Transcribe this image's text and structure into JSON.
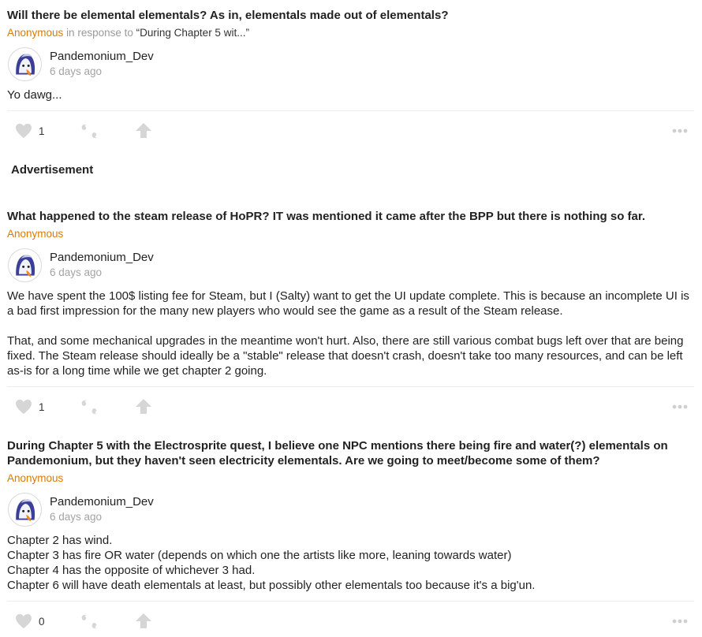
{
  "posts": [
    {
      "question": "Will there be elemental elementals? As in, elementals made out of elementals?",
      "asker": "Anonymous",
      "in_response_to": "in response to",
      "quoted": "“During Chapter 5 wit...”",
      "author": "Pandemonium_Dev",
      "time": "6 days ago",
      "answer": [
        "Yo dawg..."
      ],
      "likes": "1"
    },
    {
      "question": "What happened to the steam release of HoPR? IT was mentioned it came after the BPP but there is nothing so far.",
      "asker": "Anonymous",
      "author": "Pandemonium_Dev",
      "time": "6 days ago",
      "answer": [
        "We have spent the 100$ listing fee for Steam, but I (Salty) want to get the UI update complete. This is because an incomplete UI is a bad first impression for the many new players who would see the game as a result of the Steam release.",
        "That, and some mechanical upgrades in the meantime won't hurt. Also, there are still various combat bugs left over that are being fixed. The Steam release should ideally be a \"stable\" release that doesn't crash, doesn't take too many resources, and can be left as-is for a long time while we get chapter 2 going."
      ],
      "likes": "1"
    },
    {
      "question": "During Chapter 5 with the Electrosprite quest, I believe one NPC mentions there being fire and water(?) elementals on Pandemonium, but they haven't seen electricity elementals. Are we going to meet/become some of them?",
      "asker": "Anonymous",
      "author": "Pandemonium_Dev",
      "time": "6 days ago",
      "answer": [
        "Chapter 2 has wind.",
        "Chapter 3 has fire OR water (depends on which one the artists like more, leaning towards water)",
        "Chapter 4 has the opposite of whichever 3 had.",
        "Chapter 6 will have death elementals at least, but possibly other elementals too because it's a big'un."
      ],
      "likes": "0"
    }
  ],
  "advertisement_label": "Advertisement",
  "icons": {
    "like": "heart-icon",
    "reply": "quote-icon",
    "share": "share-arrow-icon",
    "more": "more-dots-icon"
  },
  "colors": {
    "anonymous": "#d97a06",
    "muted": "#a3a3a3",
    "icon": "#d6d6d6"
  }
}
